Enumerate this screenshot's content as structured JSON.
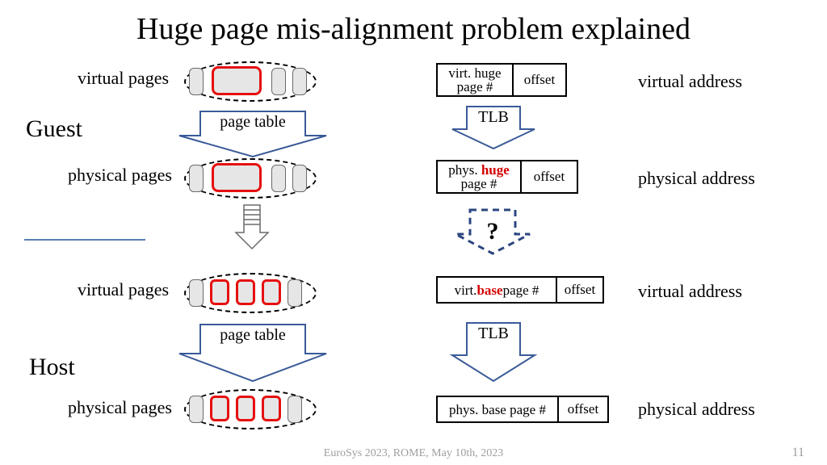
{
  "title": "Huge page mis-alignment problem explained",
  "guest_label": "Guest",
  "host_label": "Host",
  "row_labels": {
    "virtual_pages": "virtual pages",
    "physical_pages": "physical pages"
  },
  "arrow_labels": {
    "page_table": "page table",
    "tlb": "TLB",
    "question": "?"
  },
  "right_labels": {
    "virtual_address": "virtual address",
    "physical_address": "physical address"
  },
  "addr": {
    "virt_huge_l1": "virt. huge",
    "virt_huge_l2": "page #",
    "phys_pre": "phys. ",
    "phys_huge_red": "huge",
    "phys_l2": "page #",
    "virt_base_pre": "virt. ",
    "virt_base_red": "base",
    "virt_base_suf": " page #",
    "phys_base": "phys. base page #",
    "offset": "offset"
  },
  "footer": {
    "venue": "EuroSys 2023, ROME, May 10th, 2023",
    "page": "11"
  },
  "colors": {
    "accent_red": "#d40000",
    "arrow_stroke": "#3a5a98",
    "dashed_stroke": "#2c467f"
  }
}
